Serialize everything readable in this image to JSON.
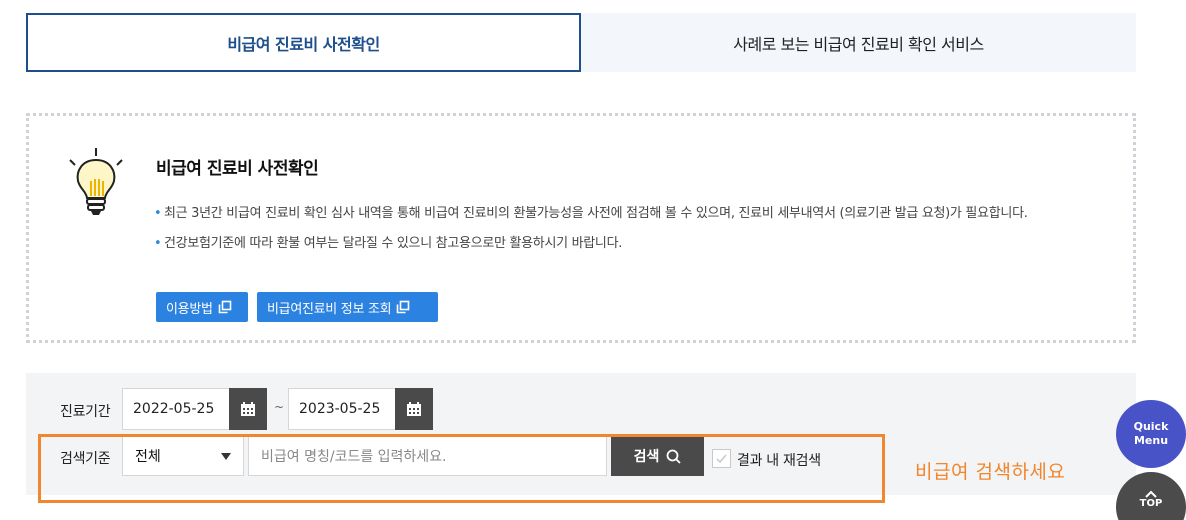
{
  "tabs": [
    {
      "label": "비급여 진료비 사전확인",
      "active": true
    },
    {
      "label": "사례로 보는 비급여 진료비 확인 서비스",
      "active": false
    }
  ],
  "info": {
    "icon": "lightbulb-icon",
    "title": "비급여 진료비 사전확인",
    "bullets": [
      "최근 3년간 비급여 진료비 확인 심사 내역을 통해 비급여 진료비의 환불가능성을 사전에 점검해 볼 수 있으며, 진료비 세부내역서 (의료기관 발급 요청)가 필요합니다.",
      "건강보험기준에 따라 환불 여부는 달라질 수 있으니 참고용으로만 활용하시기 바랍니다."
    ],
    "buttons": {
      "usage": "이용방법",
      "lookup": "비급여진료비 정보 조회"
    }
  },
  "search": {
    "period_label": "진료기간",
    "date_from": "2022-05-25",
    "date_separator": "~",
    "date_to": "2023-05-25",
    "criteria_label": "검색기준",
    "criteria_selected": "전체",
    "query_placeholder": "비급여 명칭/코드를 입력하세요.",
    "search_button": "검색",
    "refine_label": "결과 내 재검색",
    "refine_checked": false
  },
  "annotation": "비급여 검색하세요",
  "floating": {
    "quick_menu_line1": "Quick",
    "quick_menu_line2": "Menu",
    "top_label": "TOP"
  },
  "colors": {
    "accent_navy": "#1c4f8c",
    "button_blue": "#2b82e0",
    "highlight_orange": "#f0862d",
    "quick_menu": "#4853c8"
  }
}
